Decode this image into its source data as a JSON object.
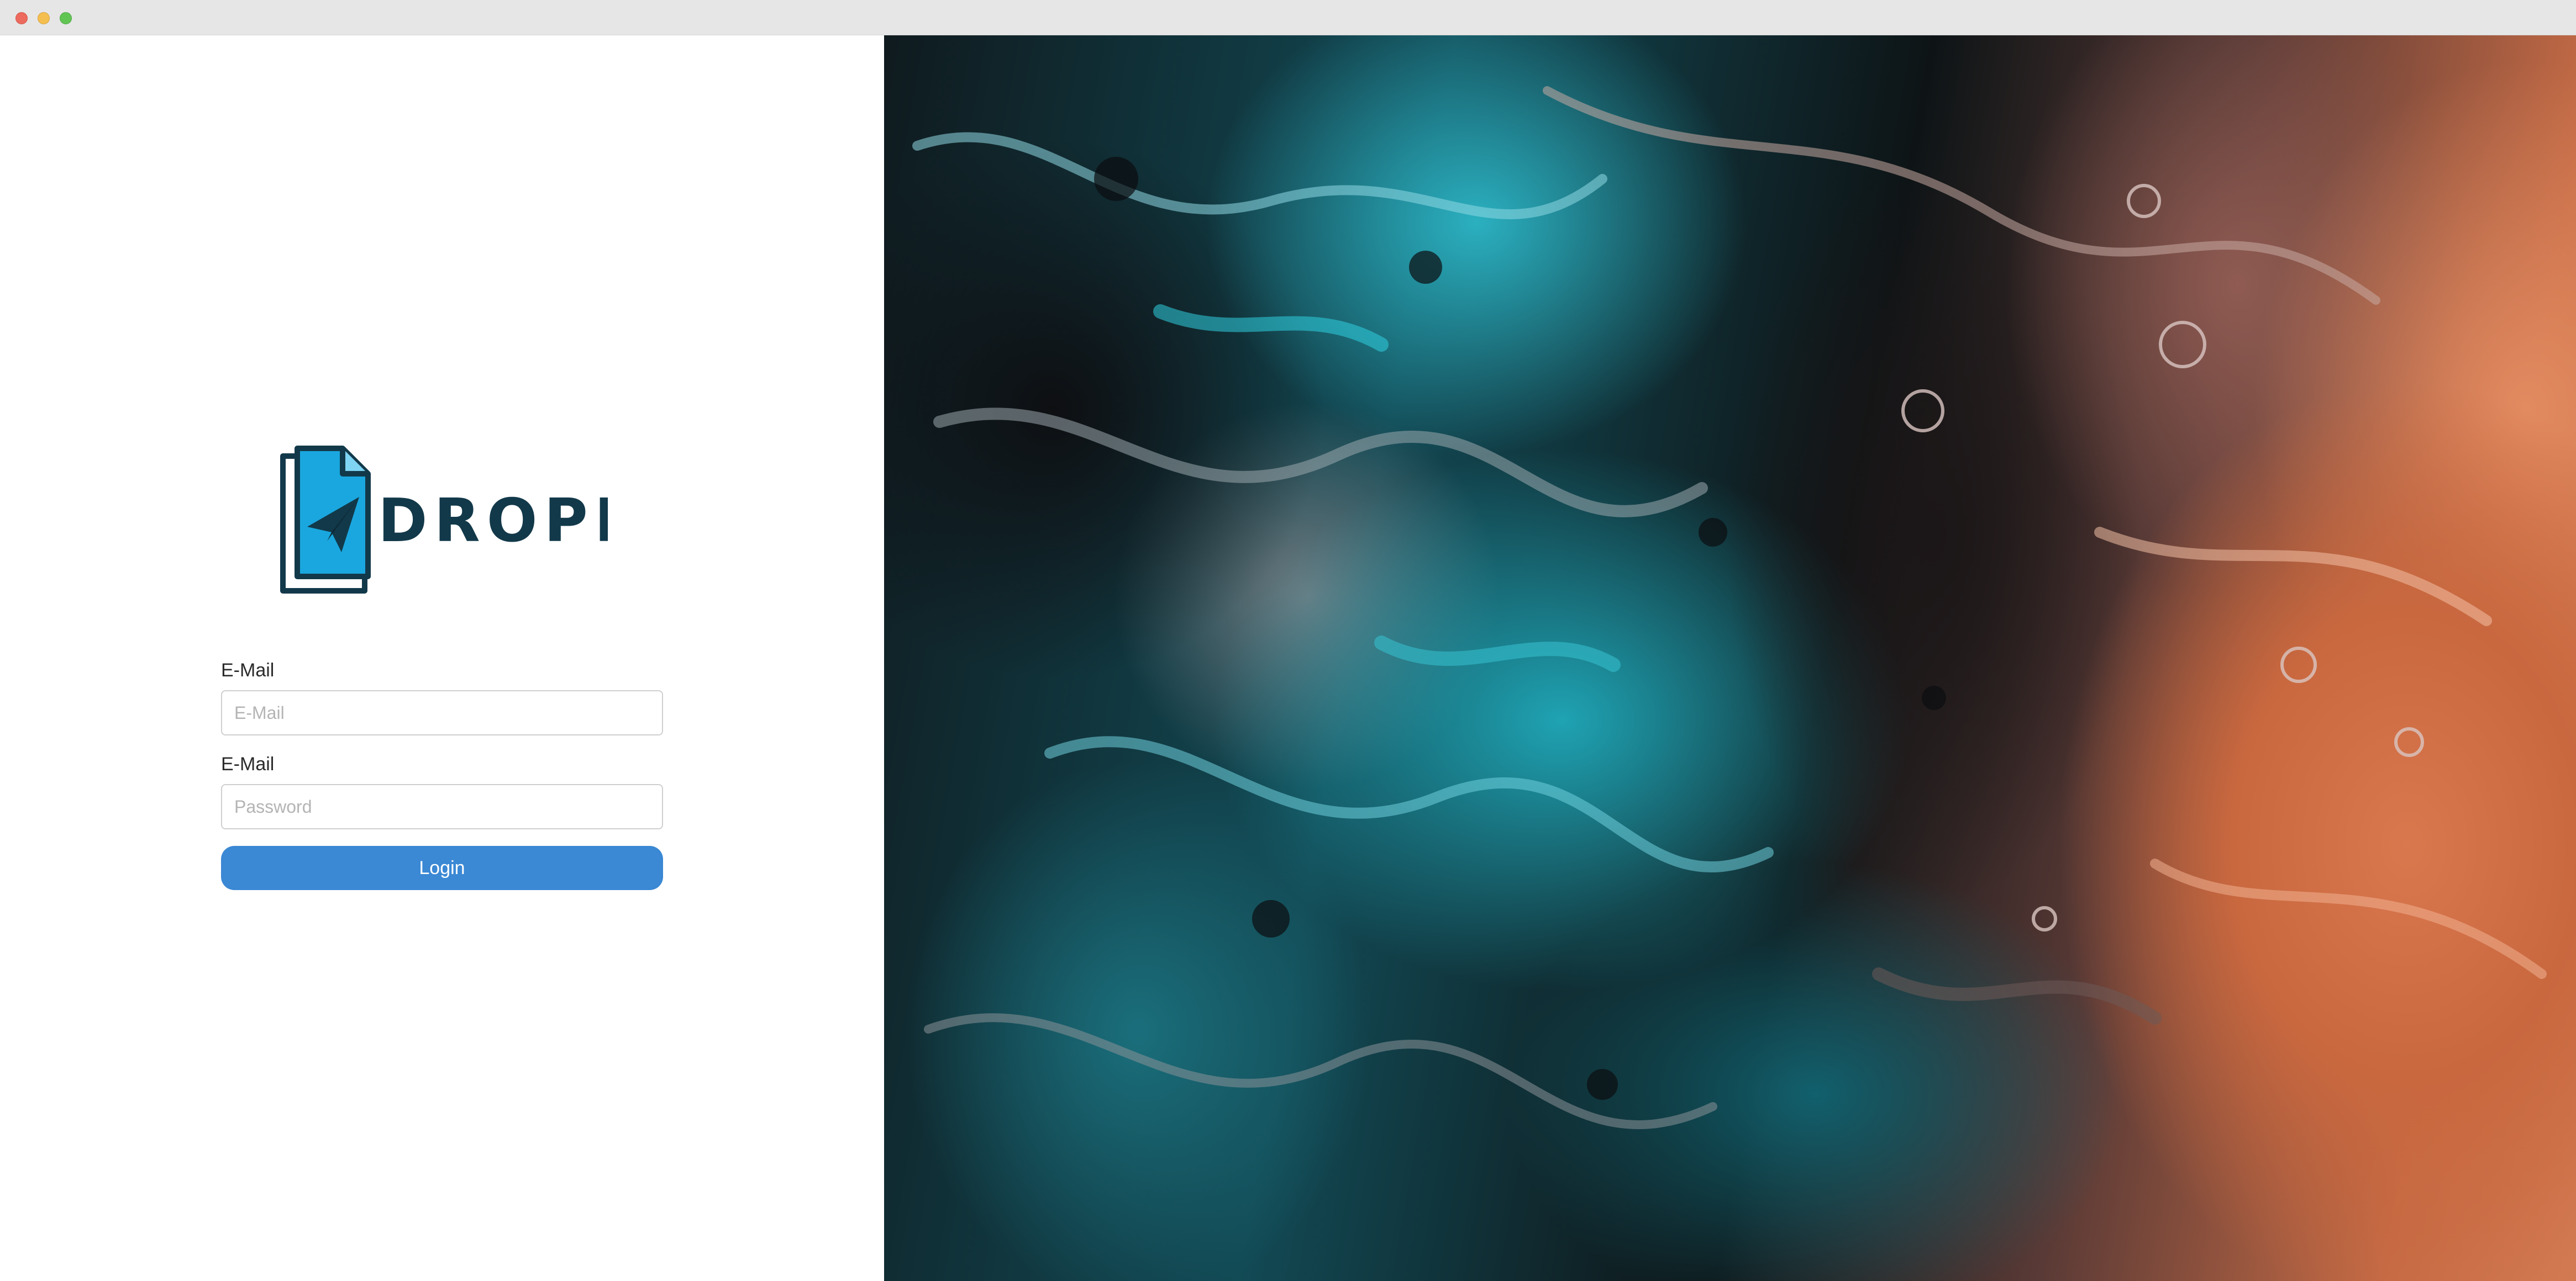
{
  "window": {
    "controls": [
      "close",
      "minimize",
      "maximize"
    ]
  },
  "logo": {
    "text": "DROPPY",
    "icon": "paper-plane-document-icon",
    "colors": {
      "primary": "#12394a",
      "accent": "#1aa7df"
    }
  },
  "form": {
    "email_label": "E-Mail",
    "email_placeholder": "E-Mail",
    "email_value": "",
    "password_label": "E-Mail",
    "password_placeholder": "Password",
    "password_value": "",
    "login_label": "Login"
  },
  "colors": {
    "button": "#3b88d4",
    "hero_teal": "#1fa3b3",
    "hero_orange": "#d9774e",
    "hero_dark": "#0e0f12"
  }
}
